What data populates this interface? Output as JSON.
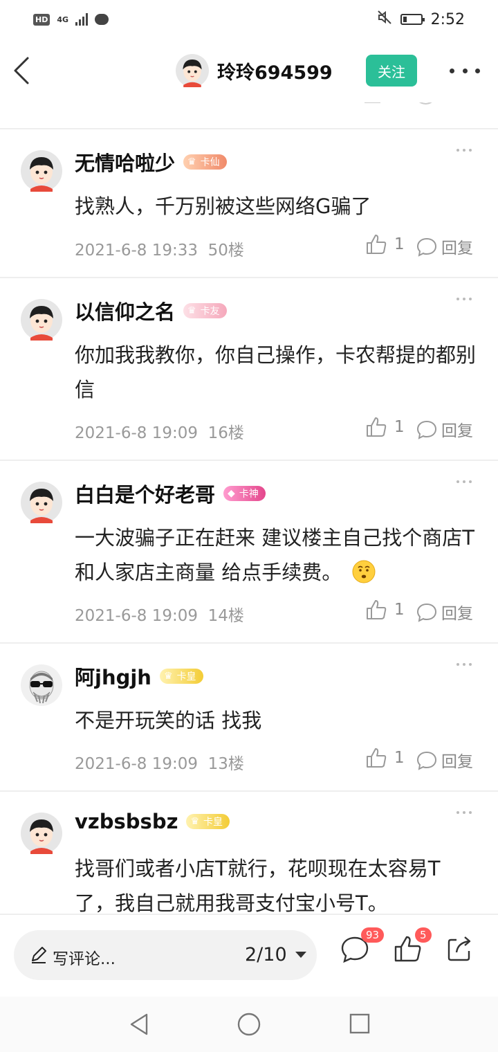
{
  "status_bar": {
    "hd": "HD",
    "network": "4G",
    "time": "2:52"
  },
  "header": {
    "title": "玲玲694599",
    "follow_label": "关注"
  },
  "comments": [
    {
      "username": "无情哈啦少",
      "badge": "卡仙",
      "text": "找熟人，千万别被这些网络G骗了",
      "date": "2021-6-8 19:33",
      "floor": "50楼",
      "likes": "1",
      "reply_label": "回复"
    },
    {
      "username": "以信仰之名",
      "badge": "卡友",
      "text": "你加我我教你，你自己操作，卡农帮提的都别信",
      "date": "2021-6-8 19:09",
      "floor": "16楼",
      "likes": "1",
      "reply_label": "回复"
    },
    {
      "username": "白白是个好老哥",
      "badge": "卡神",
      "text": "一大波骗子正在赶来 建议楼主自己找个商店T 和人家店主商量 给点手续费。",
      "date": "2021-6-8 19:09",
      "floor": "14楼",
      "likes": "1",
      "reply_label": "回复"
    },
    {
      "username": "阿jhgjh",
      "badge": "卡皇",
      "text": "不是开玩笑的话 找我",
      "date": "2021-6-8 19:09",
      "floor": "13楼",
      "likes": "1",
      "reply_label": "回复"
    },
    {
      "username": "vzbsbsbz",
      "badge": "卡皇",
      "text": "找哥们或者小店T就行，花呗现在太容易T了，我自己就用我哥支付宝小号T。"
    }
  ],
  "bottom_bar": {
    "comment_placeholder": "写评论...",
    "page_indicator": "2/10",
    "comment_count": "93",
    "like_count": "5"
  },
  "icons": {
    "back": "chevron-left-icon",
    "more": "more-horizontal-icon",
    "like": "thumbs-up-icon",
    "reply": "chat-bubble-icon",
    "share": "share-icon",
    "edit": "pen-icon"
  },
  "colors": {
    "accent": "#2bbf98",
    "badge_red": "#ff5a5a",
    "meta_gray": "#999999"
  }
}
